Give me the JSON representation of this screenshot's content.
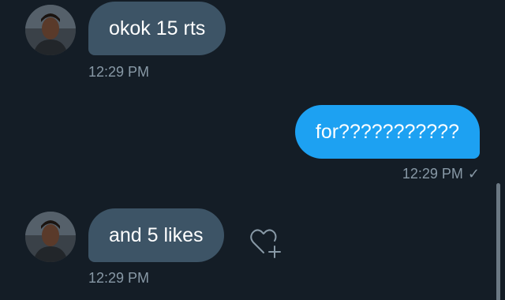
{
  "conversation": {
    "messages": [
      {
        "direction": "incoming",
        "text": "okok 15 rts",
        "time": "12:29 PM"
      },
      {
        "direction": "outgoing",
        "text": "for???????????",
        "time": "12:29 PM",
        "status": "✓"
      },
      {
        "direction": "incoming",
        "text": "and 5 likes",
        "time": "12:29 PM"
      }
    ]
  },
  "colors": {
    "background": "#141d26",
    "incoming_bubble": "#3d5466",
    "outgoing_bubble": "#1da1f2",
    "timestamp": "#8899a6"
  },
  "icons": {
    "react": "heart-plus-icon",
    "avatar": "avatar"
  }
}
